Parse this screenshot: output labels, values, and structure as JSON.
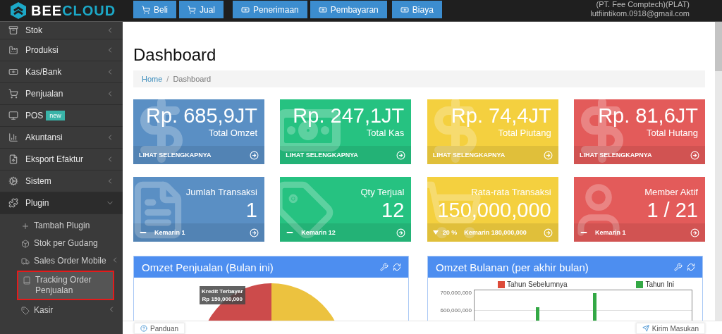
{
  "brand": {
    "primary": "BEE",
    "secondary": "CLOUD"
  },
  "toolbar": [
    {
      "label": "Beli",
      "kind": "cart"
    },
    {
      "label": "Jual",
      "kind": "cart"
    },
    {
      "label": "Penerimaan",
      "kind": "money"
    },
    {
      "label": "Pembayaran",
      "kind": "money"
    },
    {
      "label": "Biaya",
      "kind": "money"
    }
  ],
  "account": {
    "company": "(PT. Fee Comptech)(PLAT)",
    "email": "lutfiintikom.0918@gmail.com"
  },
  "sidebar": {
    "items": [
      {
        "label": "Stok",
        "expanded": false
      },
      {
        "label": "Produksi",
        "expanded": false
      },
      {
        "label": "Kas/Bank",
        "expanded": false
      },
      {
        "label": "Penjualan",
        "expanded": false
      },
      {
        "label": "POS",
        "badge": "new"
      },
      {
        "label": "Akuntansi",
        "expanded": false
      },
      {
        "label": "Eksport Efaktur",
        "expanded": false
      },
      {
        "label": "Sistem",
        "expanded": false
      },
      {
        "label": "Plugin",
        "expanded": true,
        "children": [
          {
            "label": "Tambah Plugin",
            "selected": false
          },
          {
            "label": "Stok per Gudang",
            "selected": false
          },
          {
            "label": "Sales Order Mobile",
            "selected": false,
            "expanded": false
          },
          {
            "label": "Tracking Order Penjualan",
            "selected": true
          },
          {
            "label": "Kasir",
            "selected": false,
            "expanded": false
          }
        ]
      }
    ]
  },
  "page": {
    "title": "Dashboard",
    "breadcrumb": [
      "Home",
      "Dashboard"
    ],
    "breadcrumb_separator": "/"
  },
  "summary_cards": [
    {
      "value": "Rp. 685,9JT",
      "label": "Total Omzet",
      "link": "LIHAT SELENGKAPNYA",
      "color": "#5a8fc4"
    },
    {
      "value": "Rp. 247,1JT",
      "label": "Total Kas",
      "link": "LIHAT SELENGKAPNYA",
      "color": "#26c281"
    },
    {
      "value": "Rp. 74,4JT",
      "label": "Total Piutang",
      "link": "LIHAT SELENGKAPNYA",
      "color": "#f4d03f"
    },
    {
      "value": "Rp. 81,6JT",
      "label": "Total Hutang",
      "link": "LIHAT SELENGKAPNYA",
      "color": "#e35b5a"
    }
  ],
  "stat_cards": [
    {
      "label": "Jumlah Transaksi",
      "value": "1",
      "decrease": false,
      "comparison": "Kemarin 1",
      "color": "#5a8fc4"
    },
    {
      "label": "Qty Terjual",
      "value": "12",
      "decrease": false,
      "comparison": "Kemarin 12",
      "color": "#26c281"
    },
    {
      "label": "Rata-rata Transaksi",
      "value": "150,000,000",
      "decrease": true,
      "change": "20 %",
      "comparison": "Kemarin 180,000,000",
      "color": "#f4d03f"
    },
    {
      "label": "Member Aktif",
      "value": "1 / 21",
      "decrease": false,
      "comparison": "Kemarin 1",
      "color": "#e35b5a"
    }
  ],
  "panels": [
    {
      "title": "Omzet Penjualan (Bulan ini)",
      "kind": "pie",
      "tooltip": [
        "Kredit Terbayar",
        "Rp 150,000,000"
      ]
    },
    {
      "title": "Omzet Bulanan (per akhir bulan)",
      "kind": "bar",
      "legend": [
        {
          "label": "Tahun Sebelumnya",
          "color": "#dd4b39"
        },
        {
          "label": "Tahun Ini",
          "color": "#33a845"
        }
      ],
      "y_labels": [
        "700,000,000",
        "600,000,000"
      ]
    }
  ],
  "footer": {
    "help": "Panduan",
    "feedback": "Kirim Masukan"
  }
}
